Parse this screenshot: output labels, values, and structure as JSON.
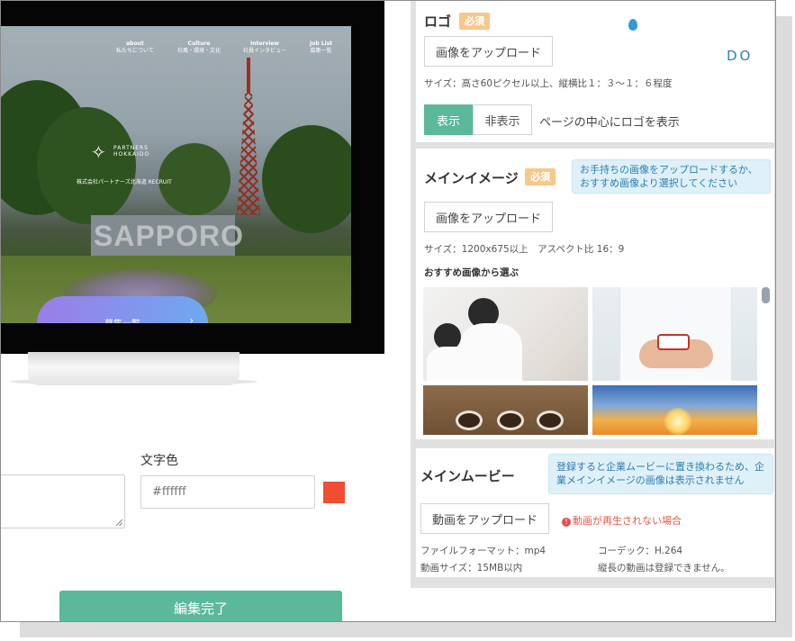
{
  "preview": {
    "nav": [
      {
        "en": "about",
        "ja": "私たちについて"
      },
      {
        "en": "Culture",
        "ja": "社風・環境・文化"
      },
      {
        "en": "Interview",
        "ja": "社員インタビュー"
      },
      {
        "en": "Job List",
        "ja": "募集一覧"
      }
    ],
    "logo_text": "PARTNERS\nHOKKAIDO",
    "company": "株式会社パートナーズ北海道 RECRUIT",
    "building_sign": "SAPPORO",
    "cta_label": "募集一覧",
    "cta_arrow": "›"
  },
  "text_color": {
    "label": "文字色",
    "placeholder": "#ffffff",
    "swatch": "#f04e30"
  },
  "complete_button": "編集完了",
  "logo_section": {
    "title": "ロゴ",
    "required": "必須",
    "upload": "画像をアップロード",
    "size_note": "サイズ：高さ60ピクセル以上、縦横比１：３〜１：６程度",
    "show": "表示",
    "hide": "非表示",
    "toggle_note": "ページの中心にロゴを表示",
    "preview_suffix": "DO"
  },
  "main_image": {
    "title": "メインイメージ",
    "required": "必須",
    "info": "お手持ちの画像をアップロードするか、おすすめ画像より選択してください",
    "upload": "画像をアップロード",
    "size_note": "サイズ：1200x675以上　アスペクト比 16：9",
    "recommended": "おすすめ画像から選ぶ"
  },
  "main_movie": {
    "title": "メインムービー",
    "info": "登録すると企業ムービーに置き換わるため、企業メインイメージの画像は表示されません",
    "upload": "動画をアップロード",
    "warning_icon": "!",
    "warning": "動画が再生されない場合",
    "format": "ファイルフォーマット：mp4",
    "codec": "コーデック：H.264",
    "size": "動画サイズ：15MB以内",
    "portrait": "縦長の動画は登録できません。"
  },
  "colors": {
    "accent": "#5bb89b",
    "required_badge": "#f6c88a",
    "info_bg": "#dff0f8",
    "info_text": "#2c7fb0",
    "warning": "#e05a4a"
  }
}
